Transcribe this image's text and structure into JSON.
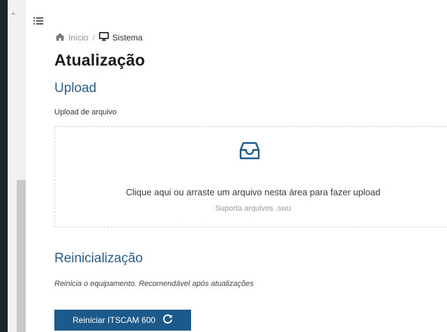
{
  "breadcrumb": {
    "home_label": "Início",
    "separator": "/",
    "current_label": "Sistema",
    "home_icon": "home-icon",
    "current_icon": "monitor-icon"
  },
  "page": {
    "title": "Atualização"
  },
  "upload": {
    "section_title": "Upload",
    "field_label": "Upload de arquivo",
    "dropzone_icon": "inbox-icon",
    "dropzone_text": "Clique aqui ou arraste um arquivo nesta área para fazer upload",
    "dropzone_hint": "Suporta arquivos .swu"
  },
  "reboot": {
    "section_title": "Reinicialização",
    "description": "Reinicia o equipamento. Recomendável após atualizações",
    "button_label": "Reiniciar ITSCAM 600",
    "button_icon": "reload-icon"
  },
  "colors": {
    "accent": "#1b5a8a",
    "section_title": "#2a5d8a",
    "sidebar": "#1f252e"
  }
}
